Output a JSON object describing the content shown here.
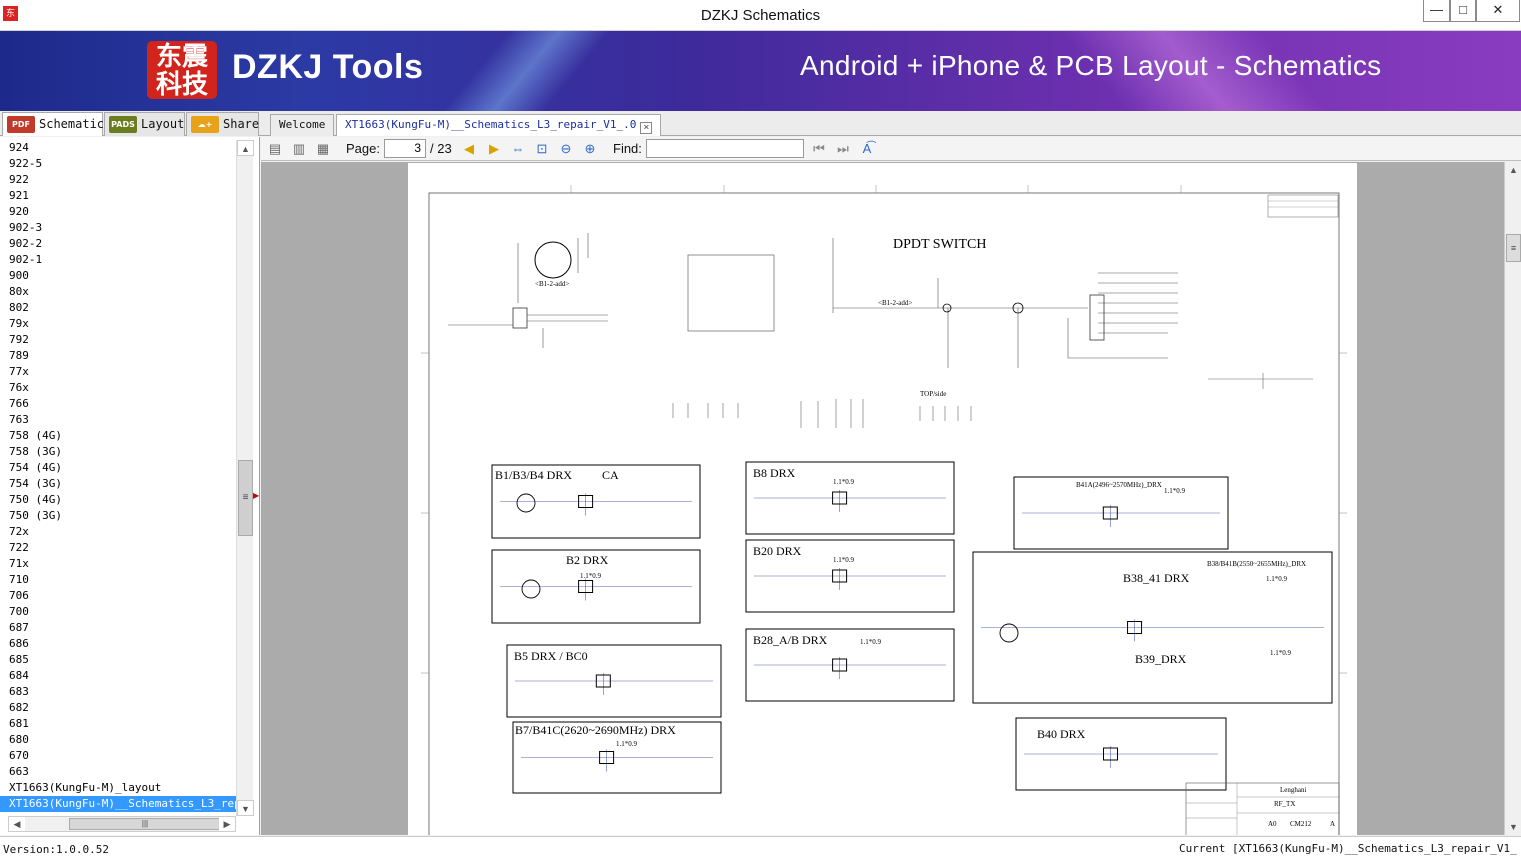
{
  "window": {
    "title": "DZKJ Schematics",
    "app_icon_text": "东",
    "minimize": "—",
    "maximize": "□",
    "close": "✕"
  },
  "banner": {
    "logo_chars": "东震\n科技",
    "logo_text": "DZKJ Tools",
    "tagline": "Android + iPhone & PCB Layout - Schematics"
  },
  "left_tabs": [
    {
      "label": "Schematic",
      "icon": "pdf-icon",
      "icon_text": "PDF",
      "icon_color": "#c0392b"
    },
    {
      "label": "Layout",
      "icon": "pads-icon",
      "icon_text": "PADS",
      "icon_color": "#6b7d1e"
    },
    {
      "label": "Share",
      "icon": "cloud-share-icon",
      "icon_text": "☁+",
      "icon_color": "#e8a21a"
    }
  ],
  "doc_tabs": [
    {
      "label": "Welcome"
    },
    {
      "label": "XT1663(KungFu-M)__Schematics_L3_repair_V1_.0",
      "close": "×"
    }
  ],
  "file_list": [
    "924",
    "922-5",
    "922",
    "921",
    "920",
    "902-3",
    "902-2",
    "902-1",
    "900",
    "80x",
    "802",
    "79x",
    "792",
    "789",
    "77x",
    "76x",
    "766",
    "763",
    "758 (4G)",
    "758 (3G)",
    "754 (4G)",
    "754 (3G)",
    "750 (4G)",
    "750 (3G)",
    "72x",
    "722",
    "71x",
    "710",
    "706",
    "700",
    "687",
    "686",
    "685",
    "684",
    "683",
    "682",
    "681",
    "680",
    "670",
    "663",
    "XT1663(KungFu-M)_layout",
    "XT1663(KungFu-M)__Schematics_L3_repair_V1_.0"
  ],
  "selected_file_index": 41,
  "toolbar": {
    "page_label": "Page:",
    "page_current": "3",
    "page_total": "/ 23",
    "find_label": "Find:",
    "find_value": ""
  },
  "schematic": {
    "heading": "DPDT SWITCH",
    "blocks": [
      {
        "title": "B1/B3/B4 DRX",
        "extra": "CA"
      },
      {
        "title": "B2 DRX",
        "extra": "1.1*0.9"
      },
      {
        "title": "B5 DRX /   BC0",
        "extra": ""
      },
      {
        "title": "B7/B41C(2620~2690MHz) DRX",
        "extra": "1.1*0.9"
      },
      {
        "title": "B8 DRX",
        "extra": "1.1*0.9"
      },
      {
        "title": "B20 DRX",
        "extra": "1.1*0.9"
      },
      {
        "title": "B28_A/B DRX",
        "extra": "1.1*0.9"
      },
      {
        "title": "B41A(2496~2570MHz)_DRX",
        "extra": "1.1*0.9"
      },
      {
        "title": "B38/B41B(2550~2655MHz)_DRX",
        "extra": ""
      },
      {
        "title": "B38_41 DRX",
        "extra": "1.1*0.9"
      },
      {
        "title": "B39_DRX",
        "extra": "1.1*0.9"
      },
      {
        "title": "B40 DRX",
        "extra": ""
      }
    ],
    "notes": [
      "<B1-2-add>",
      "<B1-2-add>",
      "TOP/side"
    ],
    "title_block": {
      "company": "Lenghani",
      "sheet": "RF_TX",
      "code": "CM212",
      "size": "A0",
      "rev": "A"
    }
  },
  "status": {
    "version": "Version:1.0.0.52",
    "current": "Current [XT1663(KungFu-M)__Schematics_L3_repair_V1_.0]"
  }
}
